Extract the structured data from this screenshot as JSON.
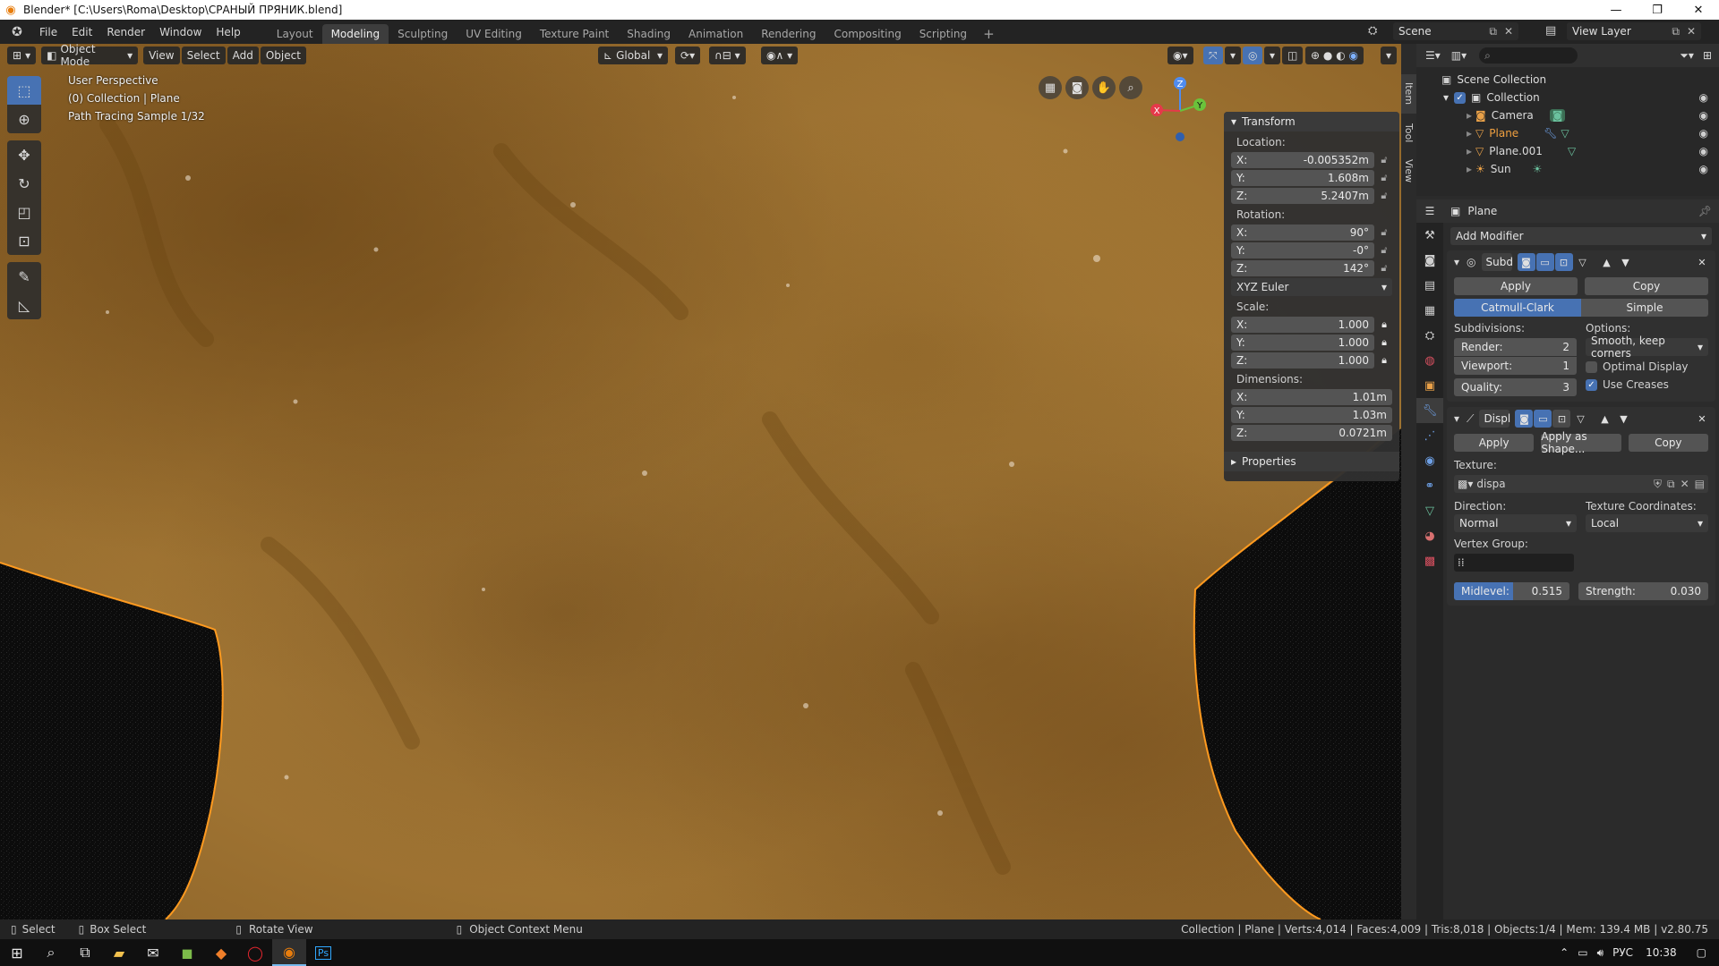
{
  "window": {
    "title": "Blender* [C:\\Users\\Roma\\Desktop\\СРАНЫЙ ПРЯНИК.blend]",
    "controls": [
      "—",
      "❐",
      "✕"
    ]
  },
  "menu": {
    "items": [
      "File",
      "Edit",
      "Render",
      "Window",
      "Help"
    ]
  },
  "workspaces": {
    "tabs": [
      "Layout",
      "Modeling",
      "Sculpting",
      "UV Editing",
      "Texture Paint",
      "Shading",
      "Animation",
      "Rendering",
      "Compositing",
      "Scripting"
    ],
    "active": "Modeling",
    "add": "+"
  },
  "scene": {
    "name": "Scene",
    "view_layer": "View Layer"
  },
  "viewport": {
    "mode": "Object Mode",
    "menus": [
      "View",
      "Select",
      "Add",
      "Object"
    ],
    "orientation": "Global",
    "info": [
      "User Perspective",
      "(0) Collection | Plane",
      "Path Tracing Sample 1/32"
    ],
    "gizmo": {
      "x": "X",
      "y": "Y",
      "z": "Z"
    },
    "colors": {
      "selection_outline": "#ff9a1f",
      "active_tool": "#4772b3"
    }
  },
  "transform": {
    "title": "Transform",
    "location_label": "Location:",
    "location": {
      "x": "-0.005352m",
      "y": "1.608m",
      "z": "5.2407m"
    },
    "rotation_label": "Rotation:",
    "rotation": {
      "x": "90°",
      "y": "-0°",
      "z": "142°"
    },
    "rotation_mode": "XYZ Euler",
    "scale_label": "Scale:",
    "scale": {
      "x": "1.000",
      "y": "1.000",
      "z": "1.000"
    },
    "dimensions_label": "Dimensions:",
    "dimensions": {
      "x": "1.01m",
      "y": "1.03m",
      "z": "0.0721m"
    },
    "properties": "Properties"
  },
  "axis_labels": {
    "x": "X:",
    "y": "Y:",
    "z": "Z:"
  },
  "side_tabs": [
    "Item",
    "Tool",
    "View"
  ],
  "outliner": {
    "root": "Scene Collection",
    "collection": "Collection",
    "items": [
      "Camera",
      "Plane",
      "Plane.001",
      "Sun"
    ]
  },
  "properties_panel": {
    "object": "Plane",
    "add_modifier": "Add Modifier",
    "subd": {
      "name": "Subd",
      "apply": "Apply",
      "copy": "Copy",
      "catmull": "Catmull-Clark",
      "simple": "Simple",
      "subdivisions": "Subdivisions:",
      "options": "Options:",
      "render_label": "Render:",
      "render": "2",
      "viewport_label": "Viewport:",
      "viewport": "1",
      "quality_label": "Quality:",
      "quality": "3",
      "uv_smooth": "Smooth, keep corners",
      "optimal_display": "Optimal Display",
      "use_creases": "Use Creases"
    },
    "displace": {
      "name": "Displ",
      "apply": "Apply",
      "apply_shape": "Apply as Shape...",
      "copy": "Copy",
      "texture_label": "Texture:",
      "texture": "dispa",
      "direction_label": "Direction:",
      "direction": "Normal",
      "texcoords_label": "Texture Coordinates:",
      "texcoords": "Local",
      "vgroup_label": "Vertex Group:",
      "midlevel_label": "Midlevel:",
      "midlevel": "0.515",
      "midlevel_fraction": 0.515,
      "strength_label": "Strength:",
      "strength": "0.030"
    }
  },
  "statusbar": {
    "select": "Select",
    "box_select": "Box Select",
    "rotate": "Rotate View",
    "context": "Object Context Menu",
    "stats": "Collection | Plane | Verts:4,014 | Faces:4,009 | Tris:8,018 | Objects:1/4 | Mem: 139.4 MB | v2.80.75"
  },
  "taskbar": {
    "lang": "РУС",
    "time": "10:38"
  }
}
